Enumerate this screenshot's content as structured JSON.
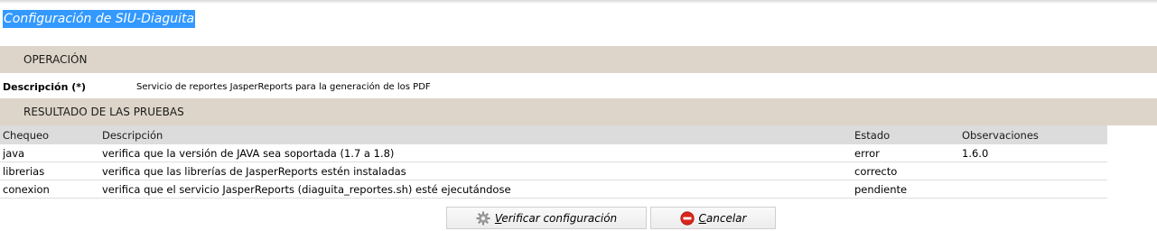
{
  "page": {
    "title": "Configuración de SIU-Diaguita"
  },
  "operacion": {
    "header": "OPERACIÓN",
    "description_label": "Descripción (*)",
    "description_value": "Servicio de reportes JasperReports para la generación de los PDF"
  },
  "resultados": {
    "header": "RESULTADO DE LAS PRUEBAS",
    "columns": [
      "Chequeo",
      "Descripción",
      "Estado",
      "Observaciones"
    ],
    "rows": [
      {
        "chequeo": "java",
        "descripcion": "verifica que la versión de JAVA sea soportada (1.7 a 1.8)",
        "estado": "error",
        "observaciones": "1.6.0"
      },
      {
        "chequeo": "librerias",
        "descripcion": "verifica que las librerías de JasperReports estén instaladas",
        "estado": "correcto",
        "observaciones": ""
      },
      {
        "chequeo": "conexion",
        "descripcion": "verifica que el servicio JasperReports (diaguita_reportes.sh) esté ejecutándose",
        "estado": "pendiente",
        "observaciones": ""
      }
    ]
  },
  "buttons": {
    "verify_first": "V",
    "verify_rest": "erificar configuración",
    "verify_icon": "gear-icon",
    "cancel_first": "C",
    "cancel_rest": "ancelar",
    "cancel_icon": "no-entry-icon"
  },
  "colors": {
    "title_highlight": "#3399ff",
    "band": "#ddd5c9",
    "table_header": "#dcdcdc",
    "cancel_icon": "#d9261c"
  }
}
